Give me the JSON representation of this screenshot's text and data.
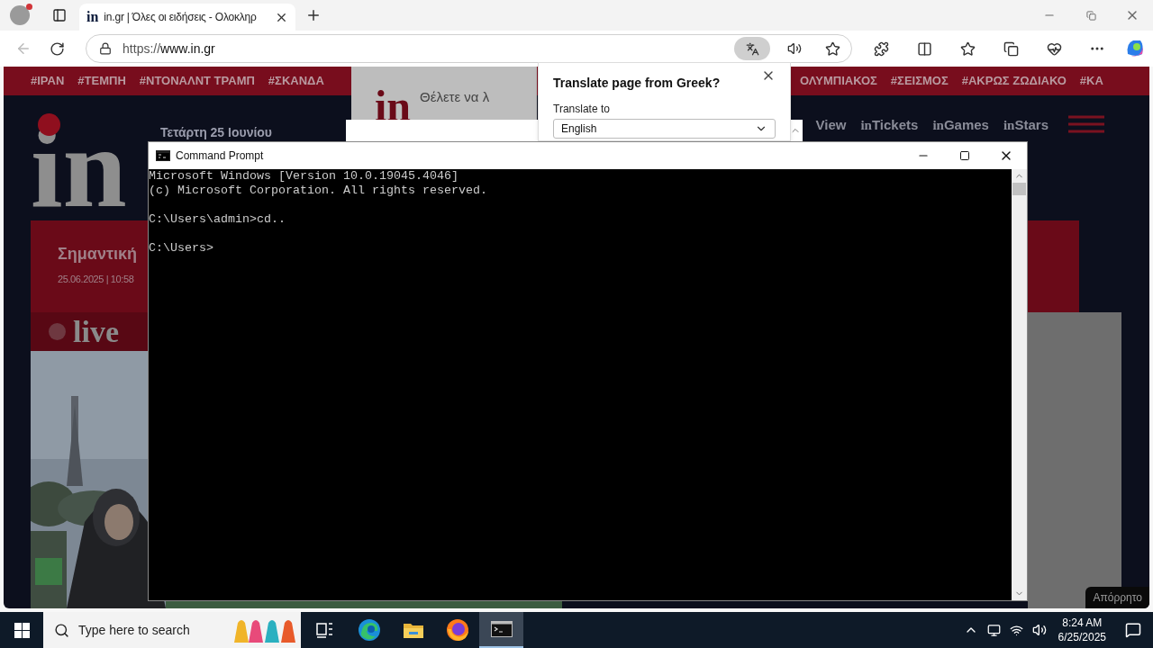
{
  "browser": {
    "tab": {
      "favicon": "in",
      "title": "in.gr | Όλες οι ειδήσεις - Ολοκληρ",
      "selected": true
    },
    "address": {
      "scheme": "https://",
      "host": "www.in.gr"
    }
  },
  "page": {
    "tags_left": [
      "#ΙΡΑΝ",
      "#ΤΕΜΠΗ",
      "#ΝΤΟΝΑΛΝΤ ΤΡΑΜΠ",
      "#ΣΚΑΝΔΑ"
    ],
    "tags_right": [
      "ΟΛΥΜΠΙΑΚΟΣ",
      "#ΣΕΙΣΜΟΣ",
      "#ΑΚΡΩΣ ΖΩΔΙΑΚΟ",
      "#ΚΑ"
    ],
    "logo": "in",
    "date": "Τετάρτη 25 Ιουνίου",
    "nav": [
      {
        "label": "View"
      },
      {
        "prefix": "in",
        "label": "Tickets"
      },
      {
        "prefix": "in",
        "label": "Games"
      },
      {
        "prefix": "in",
        "label": "Stars"
      }
    ],
    "headline": "Σημαντική",
    "timestamp": "25.06.2025 | 10:58",
    "live": "live",
    "consent": {
      "logo": "in",
      "text": "Θέλετε να λ"
    },
    "privacy": "Απόρρητο"
  },
  "translate": {
    "title": "Translate page from Greek?",
    "label": "Translate to",
    "value": "English"
  },
  "cmd": {
    "title": "Command Prompt",
    "blocks": [
      [
        "Microsoft Windows [Version 10.0.19045.4046]",
        "(c) Microsoft Corporation. All rights reserved."
      ],
      [
        "C:\\Users\\admin>cd.."
      ],
      [
        "C:\\Users>"
      ]
    ]
  },
  "taskbar": {
    "search_placeholder": "Type here to search",
    "apps": [
      {
        "kind": "task-view",
        "selected": false
      },
      {
        "kind": "edge",
        "selected": false
      },
      {
        "kind": "explorer",
        "selected": false
      },
      {
        "kind": "firefox",
        "selected": false
      },
      {
        "kind": "terminal",
        "selected": true
      }
    ],
    "time": "8:24 AM",
    "date": "6/25/2025"
  }
}
